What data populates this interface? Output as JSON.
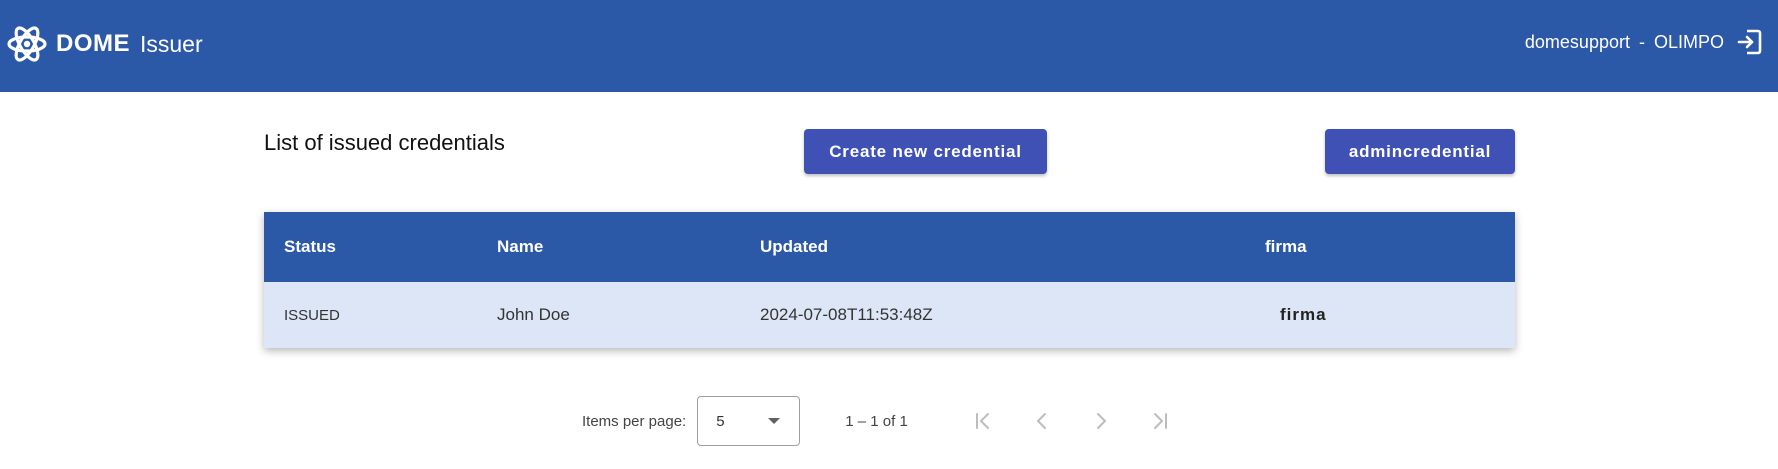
{
  "header": {
    "brand_name": "DOME",
    "brand_sub": "Issuer",
    "user_name": "domesupport",
    "separator": "-",
    "organization": "OLIMPO"
  },
  "main": {
    "title": "List of issued credentials",
    "create_button": "Create new credential",
    "admin_button": "admincredential"
  },
  "table": {
    "columns": [
      "Status",
      "Name",
      "Updated",
      "firma"
    ],
    "rows": [
      {
        "status": "ISSUED",
        "name": "John Doe",
        "updated": "2024-07-08T11:53:48Z",
        "action": "firma"
      }
    ]
  },
  "paginator": {
    "items_per_page_label": "Items per page:",
    "items_per_page_value": "5",
    "range_label": "1 – 1 of 1"
  },
  "colors": {
    "header_bg": "#2c58a8",
    "button_bg": "#3f51b5",
    "row_bg": "#dde6f6"
  },
  "icons": {
    "logo": "dome-logo-icon",
    "logout": "logout-icon",
    "dropdown": "arrow-drop-down-icon",
    "first_page": "first-page-icon",
    "prev_page": "chevron-left-icon",
    "next_page": "chevron-right-icon",
    "last_page": "last-page-icon"
  }
}
